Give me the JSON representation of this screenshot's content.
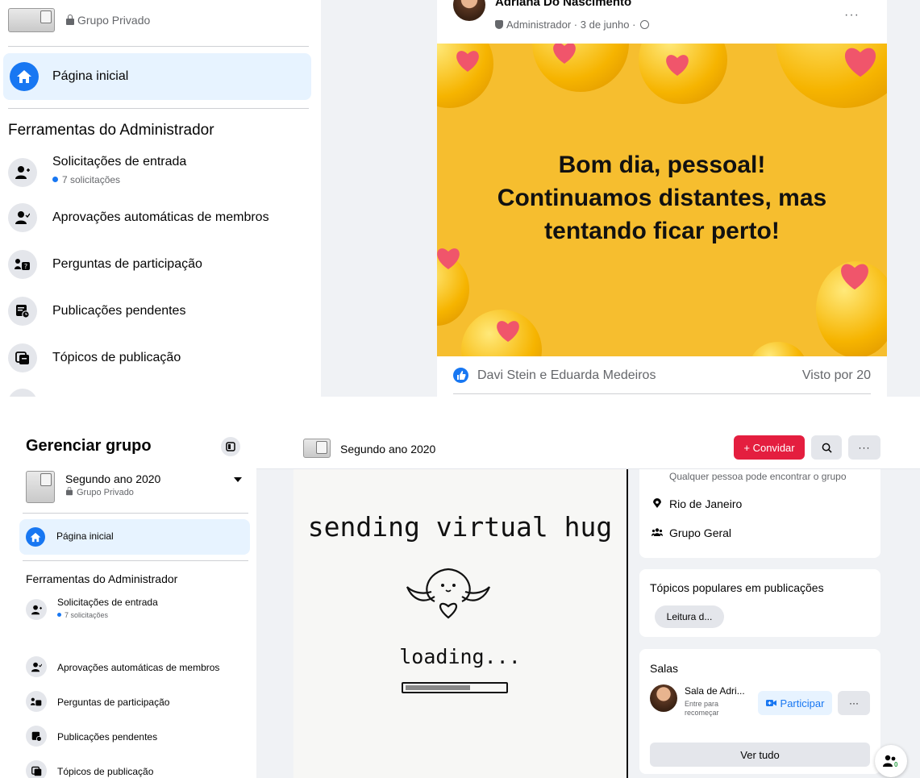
{
  "top": {
    "group_privacy": "Grupo Privado",
    "nav_home": "Página inicial",
    "admin_tools_title": "Ferramentas do Administrador",
    "tools": [
      {
        "label": "Solicitações de entrada",
        "sub": "7 solicitações"
      },
      {
        "label": "Aprovações automáticas de membros"
      },
      {
        "label": "Perguntas de participação"
      },
      {
        "label": "Publicações pendentes"
      },
      {
        "label": "Tópicos de publicação"
      }
    ],
    "post": {
      "author": "Adriana Do Nascimento",
      "meta": "Administrador · 3 de junho ·",
      "image_text_line1": "Bom dia, pessoal!",
      "image_text_line2": "Continuamos distantes, mas",
      "image_text_line3": "tentando ficar perto!",
      "reactions": "Davi Stein e Eduarda Medeiros",
      "seen": "Visto por 20",
      "more": "···"
    }
  },
  "bottom": {
    "sidebar_title": "Gerenciar grupo",
    "group_name": "Segundo ano 2020",
    "group_privacy": "Grupo Privado",
    "nav_home": "Página inicial",
    "admin_tools_title": "Ferramentas do Administrador",
    "tools": [
      {
        "label": "Solicitações de entrada",
        "sub": "7 solicitações"
      },
      {
        "label": "Aprovações automáticas de membros"
      },
      {
        "label": "Perguntas de participação"
      },
      {
        "label": "Publicações pendentes"
      },
      {
        "label": "Tópicos de publicação"
      }
    ],
    "header_group_name": "Segundo ano 2020",
    "invite_label": "+ Convidar",
    "more": "···",
    "hug_line1": "sending virtual hug",
    "hug_line2": "loading...",
    "about": {
      "visibility": "Qualquer pessoa pode encontrar o grupo",
      "location": "Rio de Janeiro",
      "type": "Grupo Geral"
    },
    "topics": {
      "title": "Tópicos populares em publicações",
      "chip": "Leitura d..."
    },
    "rooms": {
      "title": "Salas",
      "room_name": "Sala de Adri...",
      "room_sub_line1": "Entre para",
      "room_sub_line2": "recomeçar",
      "join_label": "Participar",
      "more": "···",
      "see_all": "Ver tudo"
    },
    "chat_badge": "0"
  },
  "colors": {
    "accent": "#1877f2",
    "invite": "#e41e3f",
    "bg": "#f0f2f5",
    "post_bg": "#f6be2f"
  }
}
